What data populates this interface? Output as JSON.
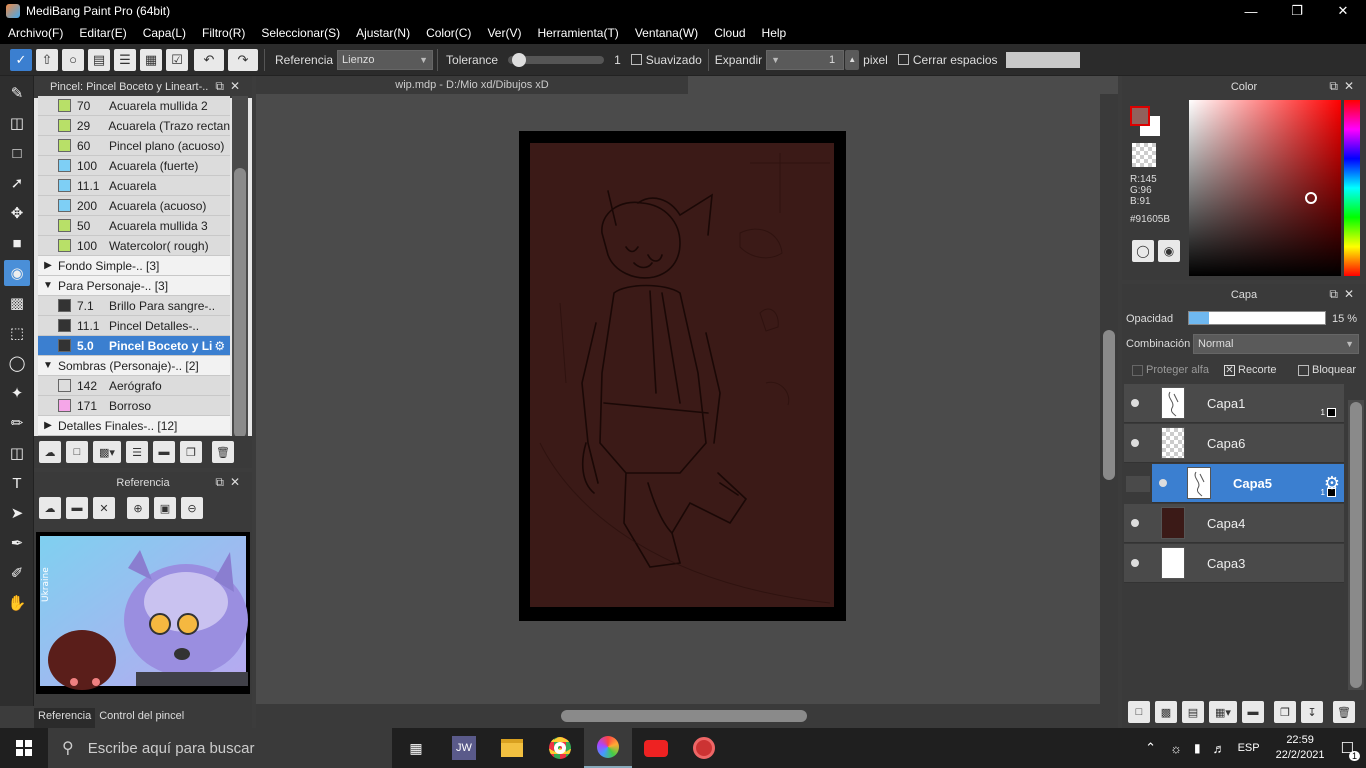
{
  "window": {
    "title": "MediBang Paint Pro (64bit)"
  },
  "menu": [
    "Archivo(F)",
    "Editar(E)",
    "Capa(L)",
    "Filtro(R)",
    "Seleccionar(S)",
    "Ajustar(N)",
    "Color(C)",
    "Ver(V)",
    "Herramienta(T)",
    "Ventana(W)",
    "Cloud",
    "Help"
  ],
  "toolbar": {
    "referencia_label": "Referencia",
    "referencia_value": "Lienzo",
    "tolerance_label": "Tolerance",
    "tolerance_value": "1",
    "tolerance_fraction": 0.05,
    "suavizado_label": "Suavizado",
    "expandir_label": "Expandir",
    "expandir_value": "1",
    "pixel_label": "pixel",
    "cerrar_label": "Cerrar espacios"
  },
  "brush_panel": {
    "title": "Pincel: Pincel Boceto y Lineart-..",
    "items": [
      {
        "kind": "brush",
        "size": "70",
        "name": "Acuarela mullida 2",
        "color": "#b8e068"
      },
      {
        "kind": "brush",
        "size": "29",
        "name": "Acuarela (Trazo rectan",
        "color": "#b8e068"
      },
      {
        "kind": "brush",
        "size": "60",
        "name": "Pincel plano (acuoso)",
        "color": "#b8e068"
      },
      {
        "kind": "brush",
        "size": "100",
        "name": "Acuarela (fuerte)",
        "color": "#7ecff5"
      },
      {
        "kind": "brush",
        "size": "11.1",
        "name": "Acuarela",
        "color": "#7ecff5"
      },
      {
        "kind": "brush",
        "size": "200",
        "name": "Acuarela (acuoso)",
        "color": "#7ecff5"
      },
      {
        "kind": "brush",
        "size": "50",
        "name": "Acuarela mullida 3",
        "color": "#b8e068"
      },
      {
        "kind": "brush",
        "size": "100",
        "name": "Watercolor( rough)",
        "color": "#b8e068"
      },
      {
        "kind": "group",
        "tri": "▶",
        "name": "Fondo Simple-.. [3]"
      },
      {
        "kind": "group",
        "tri": "▼",
        "name": "Para Personaje-.. [3]"
      },
      {
        "kind": "brush",
        "size": "7.1",
        "name": "Brillo Para sangre-..",
        "color": "#333333"
      },
      {
        "kind": "brush",
        "size": "11.1",
        "name": "Pincel Detalles-..",
        "color": "#333333"
      },
      {
        "kind": "brush",
        "size": "5.0",
        "name": "Pincel Boceto y Li",
        "color": "#333333",
        "selected": true
      },
      {
        "kind": "group",
        "tri": "▼",
        "name": "Sombras (Personaje)-.. [2]"
      },
      {
        "kind": "brush",
        "size": "142",
        "name": "Aerógrafo",
        "color": "#dddddd"
      },
      {
        "kind": "brush",
        "size": "171",
        "name": "Borroso",
        "color": "#f5a6e8"
      },
      {
        "kind": "group",
        "tri": "▶",
        "name": "Detalles Finales-.. [12]"
      }
    ]
  },
  "reference_panel": {
    "title": "Referencia",
    "watermark": "Ukraine",
    "tabs": [
      "Referencia",
      "Control del pincel"
    ]
  },
  "document": {
    "tab": "wip.mdp - D:/Mio xd/Dibujos xD"
  },
  "color_panel": {
    "title": "Color",
    "fg_color": "#91605B",
    "r": "R:145",
    "g": "G:96",
    "b": "B:91",
    "hex": "#91605B"
  },
  "layer_panel": {
    "title": "Capa",
    "opacity_label": "Opacidad",
    "opacity_value": "15 %",
    "opacity_fraction": 0.15,
    "blend_label": "Combinación",
    "blend_value": "Normal",
    "protect_alpha": "Proteger alfa",
    "clipping": "Recorte",
    "lock": "Bloquear",
    "layers": [
      {
        "name": "Capa1",
        "count": "1",
        "thumb": "sketch"
      },
      {
        "name": "Capa6",
        "count": "",
        "thumb": "transparent"
      },
      {
        "name": "Capa5",
        "count": "1",
        "thumb": "sketch",
        "selected": true
      },
      {
        "name": "Capa4",
        "count": "",
        "thumb": "#3b1a17"
      },
      {
        "name": "Capa3",
        "count": "",
        "thumb": "white"
      }
    ]
  },
  "taskbar": {
    "search_placeholder": "Escribe aquí para buscar",
    "jw_label": "JW",
    "lang": "ESP",
    "time": "22:59",
    "date": "22/2/2021",
    "notifications": "1"
  }
}
